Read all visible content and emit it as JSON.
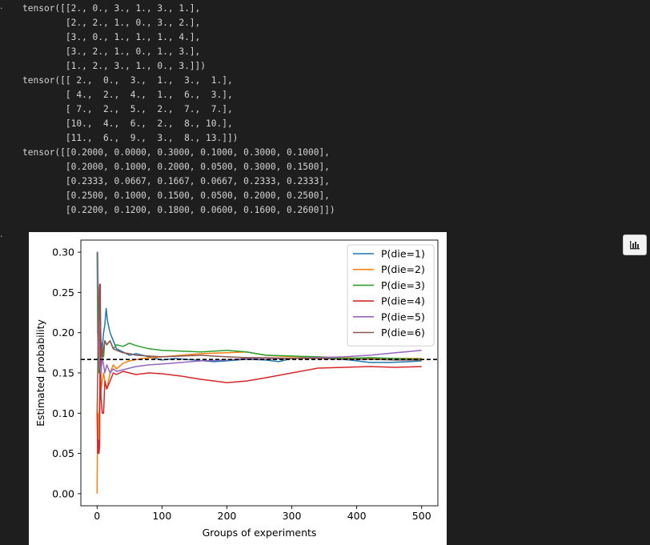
{
  "cells": {
    "out1_marker": "·",
    "out2_marker": "·"
  },
  "output_text": "tensor([[2., 0., 3., 1., 3., 1.],\n        [2., 2., 1., 0., 3., 2.],\n        [3., 0., 1., 1., 1., 4.],\n        [3., 2., 1., 0., 1., 3.],\n        [1., 2., 3., 1., 0., 3.]])\ntensor([[ 2.,  0.,  3.,  1.,  3.,  1.],\n        [ 4.,  2.,  4.,  1.,  6.,  3.],\n        [ 7.,  2.,  5.,  2.,  7.,  7.],\n        [10.,  4.,  6.,  2.,  8., 10.],\n        [11.,  6.,  9.,  3.,  8., 13.]])\ntensor([[0.2000, 0.0000, 0.3000, 0.1000, 0.3000, 0.1000],\n        [0.2000, 0.1000, 0.2000, 0.0500, 0.3000, 0.1500],\n        [0.2333, 0.0667, 0.1667, 0.0667, 0.2333, 0.2333],\n        [0.2500, 0.1000, 0.1500, 0.0500, 0.2000, 0.2500],\n        [0.2200, 0.1200, 0.1800, 0.0600, 0.1600, 0.2600]])",
  "toolbar": {
    "chart_icon": "bar-chart-icon"
  },
  "chart_data": {
    "type": "line",
    "xlabel": "Groups of experiments",
    "ylabel": "Estimated probability",
    "xlim": [
      -25,
      525
    ],
    "ylim": [
      -0.015,
      0.315
    ],
    "xticks": [
      "0",
      "100",
      "200",
      "300",
      "400",
      "500"
    ],
    "yticks": [
      "0.00",
      "0.05",
      "0.10",
      "0.15",
      "0.20",
      "0.25",
      "0.30"
    ],
    "grid": false,
    "legend_position": "top-right",
    "reference_line": {
      "y": 0.1667,
      "style": "dashed",
      "color": "#000000"
    },
    "series": [
      {
        "name": "P(die=1)",
        "color": "#1f77b4",
        "points": [
          [
            0,
            0.2
          ],
          [
            1,
            0.2
          ],
          [
            2,
            0.233
          ],
          [
            3,
            0.25
          ],
          [
            4,
            0.22
          ],
          [
            6,
            0.19
          ],
          [
            8,
            0.18
          ],
          [
            10,
            0.2
          ],
          [
            12,
            0.21
          ],
          [
            14,
            0.23
          ],
          [
            16,
            0.215
          ],
          [
            20,
            0.2
          ],
          [
            25,
            0.19
          ],
          [
            30,
            0.18
          ],
          [
            40,
            0.176
          ],
          [
            50,
            0.172
          ],
          [
            60,
            0.174
          ],
          [
            80,
            0.17
          ],
          [
            100,
            0.166
          ],
          [
            120,
            0.168
          ],
          [
            150,
            0.166
          ],
          [
            180,
            0.164
          ],
          [
            200,
            0.165
          ],
          [
            230,
            0.167
          ],
          [
            260,
            0.166
          ],
          [
            280,
            0.164
          ],
          [
            300,
            0.168
          ],
          [
            330,
            0.169
          ],
          [
            360,
            0.168
          ],
          [
            390,
            0.166
          ],
          [
            400,
            0.165
          ],
          [
            420,
            0.163
          ],
          [
            450,
            0.163
          ],
          [
            480,
            0.164
          ],
          [
            500,
            0.165
          ]
        ]
      },
      {
        "name": "P(die=2)",
        "color": "#ff7f0e",
        "points": [
          [
            0,
            0.0
          ],
          [
            1,
            0.1
          ],
          [
            2,
            0.067
          ],
          [
            3,
            0.1
          ],
          [
            4,
            0.12
          ],
          [
            6,
            0.13
          ],
          [
            8,
            0.14
          ],
          [
            10,
            0.15
          ],
          [
            12,
            0.14
          ],
          [
            15,
            0.13
          ],
          [
            20,
            0.15
          ],
          [
            25,
            0.16
          ],
          [
            30,
            0.155
          ],
          [
            40,
            0.162
          ],
          [
            50,
            0.165
          ],
          [
            70,
            0.168
          ],
          [
            100,
            0.17
          ],
          [
            130,
            0.172
          ],
          [
            160,
            0.174
          ],
          [
            200,
            0.175
          ],
          [
            230,
            0.176
          ],
          [
            260,
            0.172
          ],
          [
            300,
            0.17
          ],
          [
            340,
            0.17
          ],
          [
            380,
            0.169
          ],
          [
            420,
            0.168
          ],
          [
            460,
            0.168
          ],
          [
            500,
            0.168
          ]
        ]
      },
      {
        "name": "P(die=3)",
        "color": "#2ca02c",
        "points": [
          [
            0,
            0.3
          ],
          [
            1,
            0.2
          ],
          [
            2,
            0.167
          ],
          [
            3,
            0.15
          ],
          [
            4,
            0.18
          ],
          [
            6,
            0.17
          ],
          [
            8,
            0.18
          ],
          [
            10,
            0.17
          ],
          [
            12,
            0.19
          ],
          [
            15,
            0.185
          ],
          [
            20,
            0.19
          ],
          [
            25,
            0.18
          ],
          [
            30,
            0.185
          ],
          [
            40,
            0.183
          ],
          [
            50,
            0.187
          ],
          [
            60,
            0.184
          ],
          [
            80,
            0.18
          ],
          [
            100,
            0.178
          ],
          [
            130,
            0.177
          ],
          [
            160,
            0.176
          ],
          [
            200,
            0.178
          ],
          [
            230,
            0.176
          ],
          [
            260,
            0.172
          ],
          [
            300,
            0.171
          ],
          [
            340,
            0.17
          ],
          [
            380,
            0.168
          ],
          [
            420,
            0.169
          ],
          [
            460,
            0.168
          ],
          [
            500,
            0.167
          ]
        ]
      },
      {
        "name": "P(die=4)",
        "color": "#d62728",
        "points": [
          [
            0,
            0.1
          ],
          [
            1,
            0.05
          ],
          [
            2,
            0.067
          ],
          [
            3,
            0.05
          ],
          [
            4,
            0.06
          ],
          [
            5,
            0.26
          ],
          [
            6,
            0.12
          ],
          [
            8,
            0.1
          ],
          [
            10,
            0.1
          ],
          [
            12,
            0.14
          ],
          [
            15,
            0.13
          ],
          [
            20,
            0.14
          ],
          [
            25,
            0.15
          ],
          [
            30,
            0.148
          ],
          [
            40,
            0.152
          ],
          [
            50,
            0.15
          ],
          [
            60,
            0.148
          ],
          [
            80,
            0.15
          ],
          [
            100,
            0.149
          ],
          [
            130,
            0.146
          ],
          [
            160,
            0.142
          ],
          [
            200,
            0.138
          ],
          [
            230,
            0.14
          ],
          [
            260,
            0.144
          ],
          [
            300,
            0.15
          ],
          [
            340,
            0.156
          ],
          [
            380,
            0.157
          ],
          [
            420,
            0.158
          ],
          [
            460,
            0.157
          ],
          [
            500,
            0.158
          ]
        ]
      },
      {
        "name": "P(die=5)",
        "color": "#9467bd",
        "points": [
          [
            0,
            0.3
          ],
          [
            1,
            0.3
          ],
          [
            2,
            0.233
          ],
          [
            3,
            0.2
          ],
          [
            4,
            0.16
          ],
          [
            6,
            0.15
          ],
          [
            8,
            0.17
          ],
          [
            10,
            0.16
          ],
          [
            12,
            0.15
          ],
          [
            15,
            0.16
          ],
          [
            20,
            0.15
          ],
          [
            25,
            0.155
          ],
          [
            30,
            0.152
          ],
          [
            40,
            0.154
          ],
          [
            50,
            0.156
          ],
          [
            60,
            0.158
          ],
          [
            80,
            0.16
          ],
          [
            100,
            0.161
          ],
          [
            130,
            0.163
          ],
          [
            160,
            0.165
          ],
          [
            200,
            0.166
          ],
          [
            230,
            0.168
          ],
          [
            260,
            0.167
          ],
          [
            300,
            0.168
          ],
          [
            340,
            0.169
          ],
          [
            380,
            0.17
          ],
          [
            420,
            0.172
          ],
          [
            460,
            0.175
          ],
          [
            500,
            0.178
          ]
        ]
      },
      {
        "name": "P(die=6)",
        "color": "#8c564b",
        "points": [
          [
            0,
            0.1
          ],
          [
            1,
            0.15
          ],
          [
            2,
            0.233
          ],
          [
            3,
            0.25
          ],
          [
            4,
            0.26
          ],
          [
            6,
            0.19
          ],
          [
            8,
            0.17
          ],
          [
            10,
            0.18
          ],
          [
            12,
            0.19
          ],
          [
            15,
            0.185
          ],
          [
            20,
            0.19
          ],
          [
            25,
            0.18
          ],
          [
            30,
            0.178
          ],
          [
            40,
            0.175
          ],
          [
            50,
            0.174
          ],
          [
            60,
            0.172
          ],
          [
            80,
            0.171
          ],
          [
            100,
            0.17
          ],
          [
            130,
            0.171
          ],
          [
            160,
            0.172
          ],
          [
            200,
            0.17
          ],
          [
            230,
            0.169
          ],
          [
            260,
            0.169
          ],
          [
            300,
            0.168
          ],
          [
            340,
            0.168
          ],
          [
            380,
            0.167
          ],
          [
            420,
            0.167
          ],
          [
            460,
            0.166
          ],
          [
            500,
            0.166
          ]
        ]
      }
    ]
  }
}
